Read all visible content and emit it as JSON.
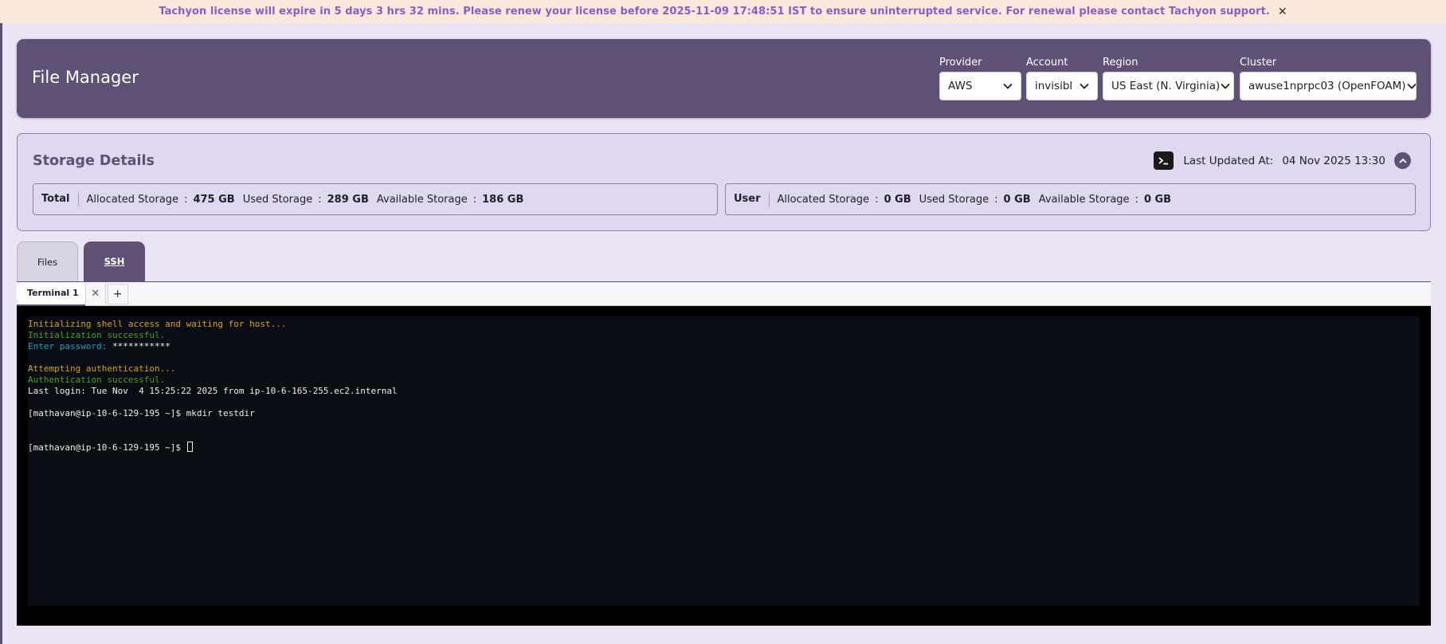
{
  "banner": {
    "text": "Tachyon license will expire in 5 days 3 hrs 32 mins. Please renew your license before 2025-11-09 17:48:51 IST to ensure uninterrupted service. For renewal please contact Tachyon support.",
    "close": "✕"
  },
  "header": {
    "title": "File Manager",
    "provider": {
      "label": "Provider",
      "value": "AWS"
    },
    "account": {
      "label": "Account",
      "value": "invisibl"
    },
    "region": {
      "label": "Region",
      "value": "US East (N. Virginia)"
    },
    "cluster": {
      "label": "Cluster",
      "value": "awuse1nprpc03 (OpenFOAM)"
    }
  },
  "storage": {
    "title": "Storage Details",
    "last_updated_label": "Last Updated At:",
    "last_updated_value": "04 Nov 2025 13:30",
    "total": {
      "head": "Total",
      "allocated_label": "Allocated Storage",
      "allocated_value": "475 GB",
      "used_label": "Used Storage",
      "used_value": "289 GB",
      "available_label": "Available Storage",
      "available_value": "186 GB"
    },
    "user": {
      "head": "User",
      "allocated_label": "Allocated Storage",
      "allocated_value": "0 GB",
      "used_label": "Used Storage",
      "used_value": "0 GB",
      "available_label": "Available Storage",
      "available_value": "0 GB"
    },
    "separator": ":"
  },
  "tabs": {
    "files": "Files",
    "ssh": "SSH"
  },
  "terminal": {
    "tab_label": "Terminal 1",
    "close": "✕",
    "add": "+",
    "lines": {
      "l1": "Initializing shell access and waiting for host...",
      "l2": "Initialization successful.",
      "l3_prompt": "Enter password: ",
      "l3_value": "***********",
      "l5": "Attempting authentication...",
      "l6": "Authentication successful.",
      "l7": "Last login: Tue Nov  4 15:25:22 2025 from ip-10-6-165-255.ec2.internal",
      "l9": "[mathavan@ip-10-6-129-195 ~]$ mkdir testdir",
      "l12": "[mathavan@ip-10-6-129-195 ~]$ "
    }
  },
  "colors": {
    "accent": "#5e5175",
    "banner_text": "#8a5cc6",
    "terminal_bg": "#0a0d14"
  }
}
